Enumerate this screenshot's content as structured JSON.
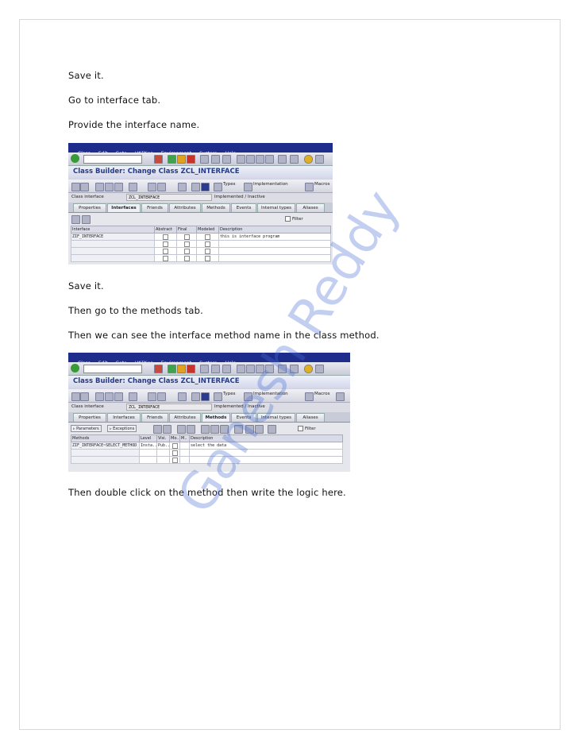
{
  "paragraphs": {
    "p1": "Save it.",
    "p2": "Go to interface tab.",
    "p3": "Provide the interface name.",
    "p4": "Save it.",
    "p5": "Then go to the methods tab.",
    "p6": "Then we can see the interface method name in the class method.",
    "p7": "Then double click on the method then write the logic here."
  },
  "watermark": "Ganesh Reddy",
  "screenshot1": {
    "menu": [
      "Class",
      "Edit",
      "Goto",
      "Utilities",
      "Environment",
      "System",
      "Help"
    ],
    "title": "Class Builder: Change Class ZCL_INTERFACE",
    "toolbar": {
      "types": "Types",
      "implementation": "Implementation",
      "macros": "Macros"
    },
    "class_interface_label": "Class interface",
    "class_interface_value": "ZCL_INTERFACE",
    "status": "Implemented / Inactive",
    "tabs": [
      "Properties",
      "Interfaces",
      "Friends",
      "Attributes",
      "Methods",
      "Events",
      "Internal types",
      "Aliases"
    ],
    "active_tab": "Interfaces",
    "filter": "Filter",
    "columns": [
      "Interface",
      "Abstract",
      "Final",
      "Modeled",
      "Description"
    ],
    "rows": [
      {
        "interface": "ZIF_INTERFACE",
        "description": "this is interface program"
      }
    ]
  },
  "screenshot2": {
    "menu": [
      "Class",
      "Edit",
      "Goto",
      "Utilities",
      "Environment",
      "System",
      "Help"
    ],
    "title": "Class Builder: Change Class ZCL_INTERFACE",
    "toolbar": {
      "types": "Types",
      "implementation": "Implementation",
      "macros": "Macros"
    },
    "class_interface_label": "Class interface",
    "class_interface_value": "ZCL_INTERFACE",
    "status": "Implemented / Inactive",
    "tabs": [
      "Properties",
      "Interfaces",
      "Friends",
      "Attributes",
      "Methods",
      "Events",
      "Internal types",
      "Aliases"
    ],
    "active_tab": "Methods",
    "parameters_btn": "Parameters",
    "exceptions_btn": "Exceptions",
    "filter": "Filter",
    "columns": [
      "Methods",
      "Level",
      "Visi.",
      "Mo..",
      "M..",
      "Description"
    ],
    "rows": [
      {
        "method": "ZIF_INTERFACE~SELECT_METHOD",
        "level": "Insta..",
        "visibility": "Pub..",
        "description": "select the data"
      }
    ]
  }
}
